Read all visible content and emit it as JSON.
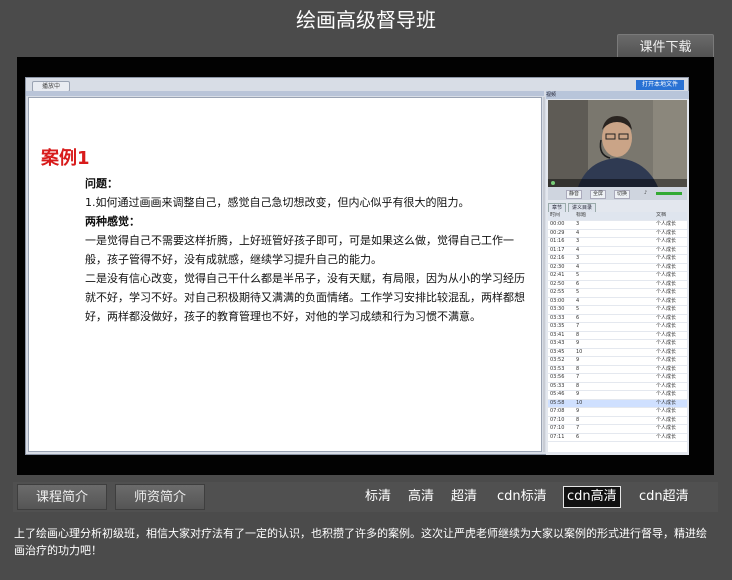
{
  "header": {
    "title": "绘画高级督导班",
    "download_label": "课件下载"
  },
  "screen": {
    "tab_label": "播放中",
    "open_label": "打开本地文件",
    "side_title": "视频",
    "slide": {
      "case_title": "案例1",
      "question_label": "问题：",
      "question_text": "1.如何通过画画来调整自己，感觉自己急切想改变，但内心似乎有很大的阻力。",
      "feelings_label": "两种感觉：",
      "paragraph1": "一是觉得自己不需要这样折腾，上好班管好孩子即可，可是如果这么做，觉得自己工作一般，孩子管得不好，没有成就感，继续学习提升自己的能力。",
      "paragraph2": "二是没有信心改变，觉得自己干什么都是半吊子，没有天赋，有局限，因为从小的学习经历就不好，学习不好。对自己积极期待又满满的负面情绪。工作学习安排比较混乱，两样都想好，两样都没做好，孩子的教育管理也不好，对他的学习成绩和行为习惯不满意。"
    },
    "controls": {
      "b1": "静音",
      "b2": "全屏",
      "b3": "切换"
    },
    "list_tabs": [
      "章节",
      "讲义目录"
    ],
    "table": {
      "headers": [
        "时间",
        "标题",
        "文档"
      ],
      "rows": [
        [
          "00:00",
          "3",
          "个人成长"
        ],
        [
          "00:29",
          "4",
          "个人成长"
        ],
        [
          "01:16",
          "3",
          "个人成长"
        ],
        [
          "01:17",
          "4",
          "个人成长"
        ],
        [
          "02:16",
          "3",
          "个人成长"
        ],
        [
          "02:30",
          "4",
          "个人成长"
        ],
        [
          "02:41",
          "5",
          "个人成长"
        ],
        [
          "02:50",
          "6",
          "个人成长"
        ],
        [
          "02:55",
          "5",
          "个人成长"
        ],
        [
          "03:00",
          "4",
          "个人成长"
        ],
        [
          "03:30",
          "5",
          "个人成长"
        ],
        [
          "03:33",
          "6",
          "个人成长"
        ],
        [
          "03:35",
          "7",
          "个人成长"
        ],
        [
          "03:41",
          "8",
          "个人成长"
        ],
        [
          "03:43",
          "9",
          "个人成长"
        ],
        [
          "03:45",
          "10",
          "个人成长"
        ],
        [
          "03:52",
          "9",
          "个人成长"
        ],
        [
          "03:53",
          "8",
          "个人成长"
        ],
        [
          "03:56",
          "7",
          "个人成长"
        ],
        [
          "05:33",
          "8",
          "个人成长"
        ],
        [
          "05:46",
          "9",
          "个人成长"
        ],
        [
          "05:58",
          "10",
          "个人成长"
        ],
        [
          "07:08",
          "9",
          "个人成长"
        ],
        [
          "07:10",
          "8",
          "个人成长"
        ],
        [
          "07:10",
          "7",
          "个人成长"
        ],
        [
          "07:11",
          "6",
          "个人成长"
        ]
      ],
      "selected_index": 21
    }
  },
  "bottom_tabs": {
    "intro": "课程简介",
    "teacher": "师资简介"
  },
  "quality": {
    "q1": "标清",
    "q2": "高清",
    "q3": "超清",
    "q4": "cdn标清",
    "q5": "cdn高清",
    "q6": "cdn超清"
  },
  "description": "上了绘画心理分析初级班，相信大家对疗法有了一定的认识，也积攒了许多的案例。这次让严虎老师继续为大家以案例的形式进行督导，精进绘画治疗的功力吧！"
}
